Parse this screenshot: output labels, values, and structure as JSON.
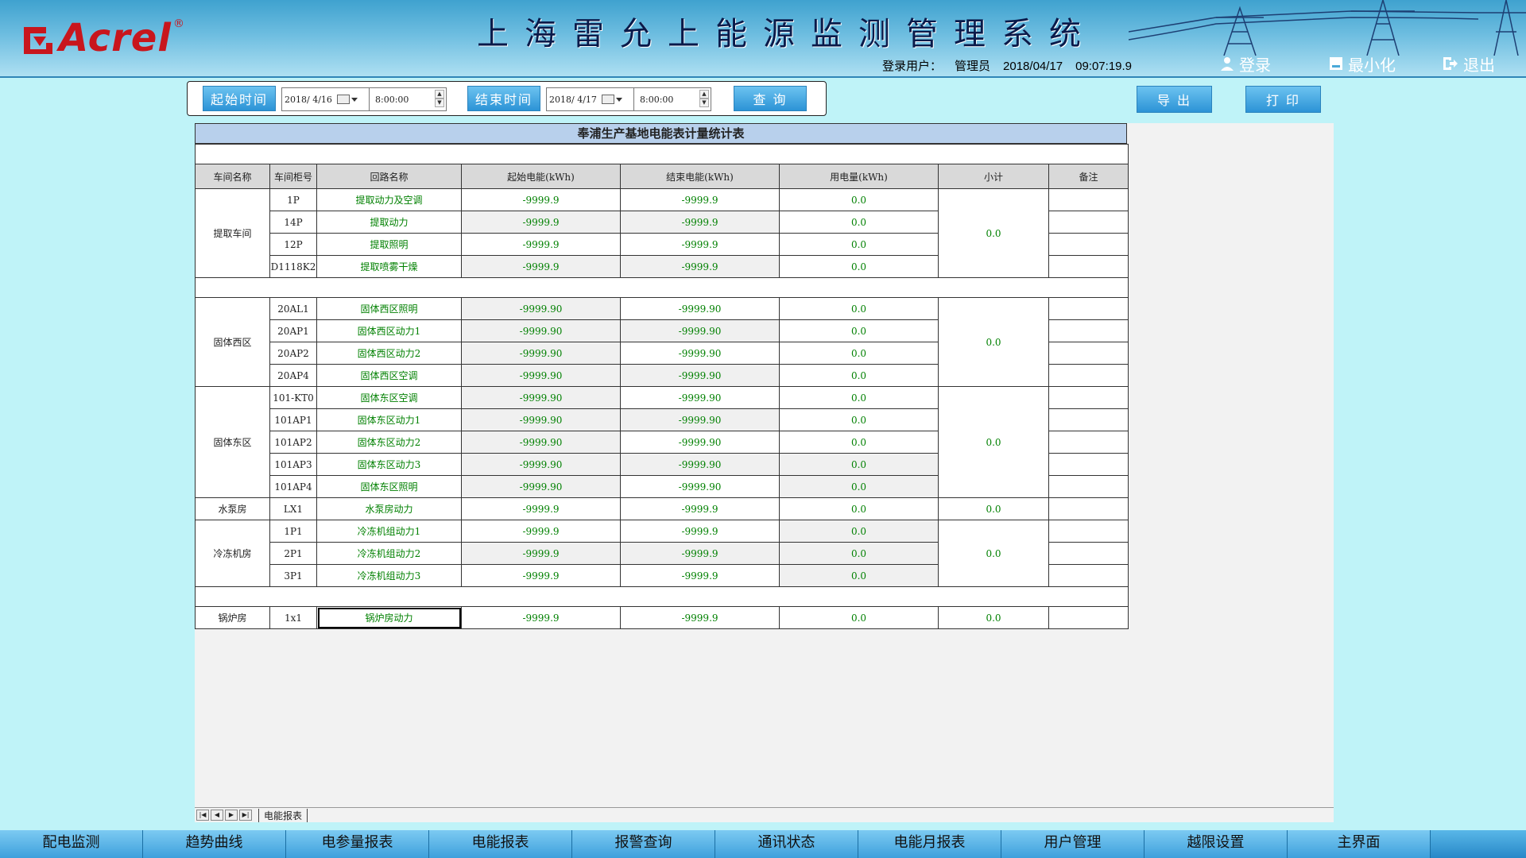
{
  "header": {
    "logo_text": "Acrel",
    "logo_reg": "®",
    "title": "上海雷允上能源监测管理系统",
    "user_label": "登录用户：",
    "user_name": "管理员",
    "date": "2018/04/17",
    "time": "09:07:19.9",
    "login_label": "登录",
    "minimize_label": "最小化",
    "exit_label": "退出"
  },
  "query": {
    "start_label": "起始时间",
    "start_date": "2018/ 4/16",
    "start_time": "8:00:00",
    "end_label": "结束时间",
    "end_date": "2018/ 4/17",
    "end_time": "8:00:00",
    "query_label": "查 询",
    "export_label": "导 出",
    "print_label": "打 印"
  },
  "report": {
    "title": "奉浦生产基地电能表计量统计表",
    "columns": [
      "车间名称",
      "车间柜号",
      "回路名称",
      "起始电能(kWh)",
      "结束电能(kWh)",
      "用电量(kWh)",
      "小计",
      "备注"
    ],
    "groups": [
      {
        "name": "提取车间",
        "subtotal": "0.0",
        "rows": [
          {
            "cab": "1P",
            "loop": "提取动力及空调",
            "start": "-9999.9",
            "end": "-9999.9",
            "usage": "0.0"
          },
          {
            "cab": "14P",
            "loop": "提取动力",
            "start": "-9999.9",
            "end": "-9999.9",
            "usage": "0.0"
          },
          {
            "cab": "12P",
            "loop": "提取照明",
            "start": "-9999.9",
            "end": "-9999.9",
            "usage": "0.0"
          },
          {
            "cab": "D1118K2",
            "loop": "提取喷雾干燥",
            "start": "-9999.9",
            "end": "-9999.9",
            "usage": "0.0"
          }
        ]
      },
      {
        "name": "固体西区",
        "subtotal": "0.0",
        "rows": [
          {
            "cab": "20AL1",
            "loop": "固体西区照明",
            "start": "-9999.90",
            "end": "-9999.90",
            "usage": "0.0"
          },
          {
            "cab": "20AP1",
            "loop": "固体西区动力1",
            "start": "-9999.90",
            "end": "-9999.90",
            "usage": "0.0"
          },
          {
            "cab": "20AP2",
            "loop": "固体西区动力2",
            "start": "-9999.90",
            "end": "-9999.90",
            "usage": "0.0"
          },
          {
            "cab": "20AP4",
            "loop": "固体西区空调",
            "start": "-9999.90",
            "end": "-9999.90",
            "usage": "0.0"
          }
        ]
      },
      {
        "name": "固体东区",
        "subtotal": "0.0",
        "rows": [
          {
            "cab": "101-KT0",
            "loop": "固体东区空调",
            "start": "-9999.90",
            "end": "-9999.90",
            "usage": "0.0"
          },
          {
            "cab": "101AP1",
            "loop": "固体东区动力1",
            "start": "-9999.90",
            "end": "-9999.90",
            "usage": "0.0"
          },
          {
            "cab": "101AP2",
            "loop": "固体东区动力2",
            "start": "-9999.90",
            "end": "-9999.90",
            "usage": "0.0"
          },
          {
            "cab": "101AP3",
            "loop": "固体东区动力3",
            "start": "-9999.90",
            "end": "-9999.90",
            "usage": "0.0"
          },
          {
            "cab": "101AP4",
            "loop": "固体东区照明",
            "start": "-9999.90",
            "end": "-9999.90",
            "usage": "0.0"
          }
        ]
      },
      {
        "name": "水泵房",
        "subtotal": "0.0",
        "rows": [
          {
            "cab": "LX1",
            "loop": "水泵房动力",
            "start": "-9999.9",
            "end": "-9999.9",
            "usage": "0.0"
          }
        ]
      },
      {
        "name": "冷冻机房",
        "subtotal": "0.0",
        "rows": [
          {
            "cab": "1P1",
            "loop": "冷冻机组动力1",
            "start": "-9999.9",
            "end": "-9999.9",
            "usage": "0.0"
          },
          {
            "cab": "2P1",
            "loop": "冷冻机组动力2",
            "start": "-9999.9",
            "end": "-9999.9",
            "usage": "0.0"
          },
          {
            "cab": "3P1",
            "loop": "冷冻机组动力3",
            "start": "-9999.9",
            "end": "-9999.9",
            "usage": "0.0"
          }
        ]
      },
      {
        "name": "锅炉房",
        "subtotal": "0.0",
        "rows": [
          {
            "cab": "1x1",
            "loop": "锅炉房动力",
            "start": "-9999.9",
            "end": "-9999.9",
            "usage": "0.0"
          }
        ]
      }
    ]
  },
  "sheet_tab": "电能报表",
  "bottom_nav": [
    "配电监测",
    "趋势曲线",
    "电参量报表",
    "电能报表",
    "报警查询",
    "通讯状态",
    "电能月报表",
    "用户管理",
    "越限设置",
    "主界面"
  ],
  "colors": {
    "accent": "#2c93d6",
    "value_green": "#008000",
    "background": "#bff3f8"
  }
}
